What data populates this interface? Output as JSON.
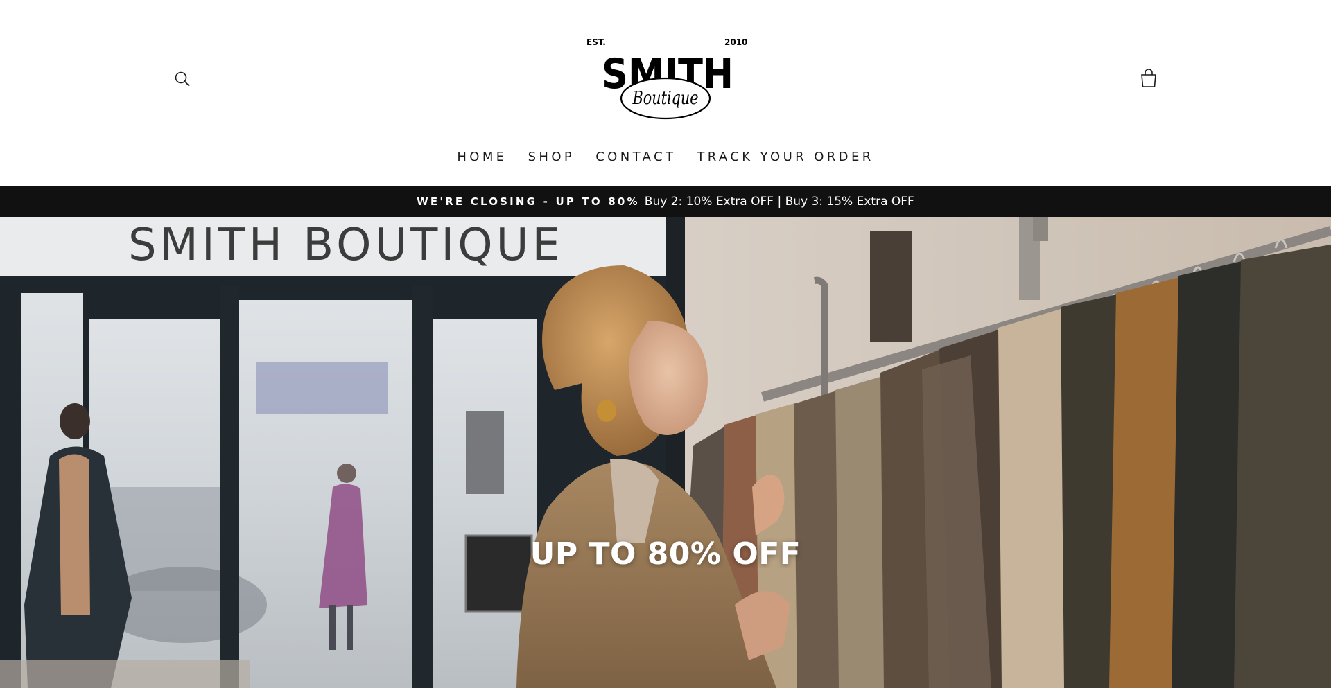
{
  "header": {
    "logo": {
      "est": "EST.",
      "year": "2010",
      "wordmark": "SMITH",
      "script": "Boutique"
    },
    "search_icon": "search-icon",
    "cart_icon": "shopping-bag-icon"
  },
  "nav": {
    "items": [
      {
        "label": "HOME"
      },
      {
        "label": "SHOP"
      },
      {
        "label": "CONTACT"
      },
      {
        "label": "TRACK YOUR ORDER"
      }
    ]
  },
  "announcement": {
    "bold": "WE'RE CLOSING - UP TO 80%",
    "text": "Buy 2: 10% Extra OFF | Buy 3: 15% Extra OFF"
  },
  "hero": {
    "storefront_sign": "SMITH BOUTIQUE",
    "title": "UP TO 80% OFF"
  },
  "colors": {
    "announcement_bg": "#111111",
    "text_dark": "#1a1a1a",
    "white": "#ffffff"
  }
}
